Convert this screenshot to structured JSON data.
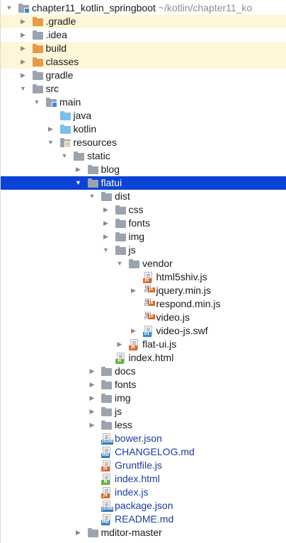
{
  "project": {
    "name": "chapter11_kotlin_springboot",
    "path": "~/kotlin/chapter11_ko"
  },
  "tree": [
    {
      "label": "chapter11_kotlin_springboot",
      "depth": 0,
      "arrow": "expanded",
      "icon": "project-folder",
      "hint": "~/kotlin/chapter11_ko"
    },
    {
      "label": ".gradle",
      "depth": 1,
      "arrow": "collapsed",
      "icon": "folder-orange",
      "style": "excluded"
    },
    {
      "label": ".idea",
      "depth": 1,
      "arrow": "collapsed",
      "icon": "folder-gray"
    },
    {
      "label": "build",
      "depth": 1,
      "arrow": "collapsed",
      "icon": "folder-orange",
      "style": "excluded"
    },
    {
      "label": "classes",
      "depth": 1,
      "arrow": "collapsed",
      "icon": "folder-orange",
      "style": "excluded"
    },
    {
      "label": "gradle",
      "depth": 1,
      "arrow": "collapsed",
      "icon": "folder-gray"
    },
    {
      "label": "src",
      "depth": 1,
      "arrow": "expanded",
      "icon": "folder-gray"
    },
    {
      "label": "main",
      "depth": 2,
      "arrow": "expanded",
      "icon": "folder-module"
    },
    {
      "label": "java",
      "depth": 3,
      "arrow": "none",
      "icon": "folder-blue"
    },
    {
      "label": "kotlin",
      "depth": 3,
      "arrow": "collapsed",
      "icon": "folder-blue"
    },
    {
      "label": "resources",
      "depth": 3,
      "arrow": "expanded",
      "icon": "folder-resources"
    },
    {
      "label": "static",
      "depth": 4,
      "arrow": "expanded",
      "icon": "folder-gray"
    },
    {
      "label": "blog",
      "depth": 5,
      "arrow": "collapsed",
      "icon": "folder-gray"
    },
    {
      "label": "flatui",
      "depth": 5,
      "arrow": "expanded",
      "icon": "folder-gray",
      "style": "selected"
    },
    {
      "label": "dist",
      "depth": 6,
      "arrow": "expanded",
      "icon": "folder-gray"
    },
    {
      "label": "css",
      "depth": 7,
      "arrow": "collapsed",
      "icon": "folder-gray"
    },
    {
      "label": "fonts",
      "depth": 7,
      "arrow": "collapsed",
      "icon": "folder-gray"
    },
    {
      "label": "img",
      "depth": 7,
      "arrow": "collapsed",
      "icon": "folder-gray"
    },
    {
      "label": "js",
      "depth": 7,
      "arrow": "expanded",
      "icon": "folder-gray"
    },
    {
      "label": "vendor",
      "depth": 8,
      "arrow": "expanded",
      "icon": "folder-gray"
    },
    {
      "label": "html5shiv.js",
      "depth": 9,
      "arrow": "none",
      "icon": "file-js"
    },
    {
      "label": "jquery.min.js",
      "depth": 9,
      "arrow": "collapsed",
      "icon": "file-binary-js"
    },
    {
      "label": "respond.min.js",
      "depth": 9,
      "arrow": "none",
      "icon": "file-binary-js"
    },
    {
      "label": "video.js",
      "depth": 9,
      "arrow": "none",
      "icon": "file-binary-js"
    },
    {
      "label": "video-js.swf",
      "depth": 9,
      "arrow": "collapsed",
      "icon": "file-swf"
    },
    {
      "label": "flat-ui.js",
      "depth": 8,
      "arrow": "collapsed",
      "icon": "file-js"
    },
    {
      "label": "index.html",
      "depth": 7,
      "arrow": "none",
      "icon": "file-html"
    },
    {
      "label": "docs",
      "depth": 6,
      "arrow": "collapsed",
      "icon": "folder-gray"
    },
    {
      "label": "fonts",
      "depth": 6,
      "arrow": "collapsed",
      "icon": "folder-gray"
    },
    {
      "label": "img",
      "depth": 6,
      "arrow": "collapsed",
      "icon": "folder-gray"
    },
    {
      "label": "js",
      "depth": 6,
      "arrow": "collapsed",
      "icon": "folder-gray"
    },
    {
      "label": "less",
      "depth": 6,
      "arrow": "collapsed",
      "icon": "folder-gray"
    },
    {
      "label": "bower.json",
      "depth": 6,
      "arrow": "none",
      "icon": "file-json",
      "color": "blue"
    },
    {
      "label": "CHANGELOG.md",
      "depth": 6,
      "arrow": "none",
      "icon": "file-md",
      "color": "blue"
    },
    {
      "label": "Gruntfile.js",
      "depth": 6,
      "arrow": "none",
      "icon": "file-js",
      "color": "blue"
    },
    {
      "label": "index.html",
      "depth": 6,
      "arrow": "none",
      "icon": "file-html",
      "color": "blue"
    },
    {
      "label": "index.js",
      "depth": 6,
      "arrow": "none",
      "icon": "file-js",
      "color": "blue"
    },
    {
      "label": "package.json",
      "depth": 6,
      "arrow": "none",
      "icon": "file-json",
      "color": "blue"
    },
    {
      "label": "README.md",
      "depth": 6,
      "arrow": "none",
      "icon": "file-md",
      "color": "blue"
    },
    {
      "label": "mditor-master",
      "depth": 5,
      "arrow": "collapsed",
      "icon": "folder-gray"
    }
  ],
  "tags": {
    "js": "JS",
    "html": "H",
    "json": "JSON",
    "md": "MD",
    "swf": "01",
    "binary": "101\n010"
  },
  "colors": {
    "selection": "#0b43d6",
    "excluded_row": "#fdf6d8",
    "vcs_blue_text": "#1a3c9e",
    "folder_orange": "#e79a4a",
    "folder_blue": "#7cc0e8",
    "folder_gray": "#9aa4ae"
  }
}
